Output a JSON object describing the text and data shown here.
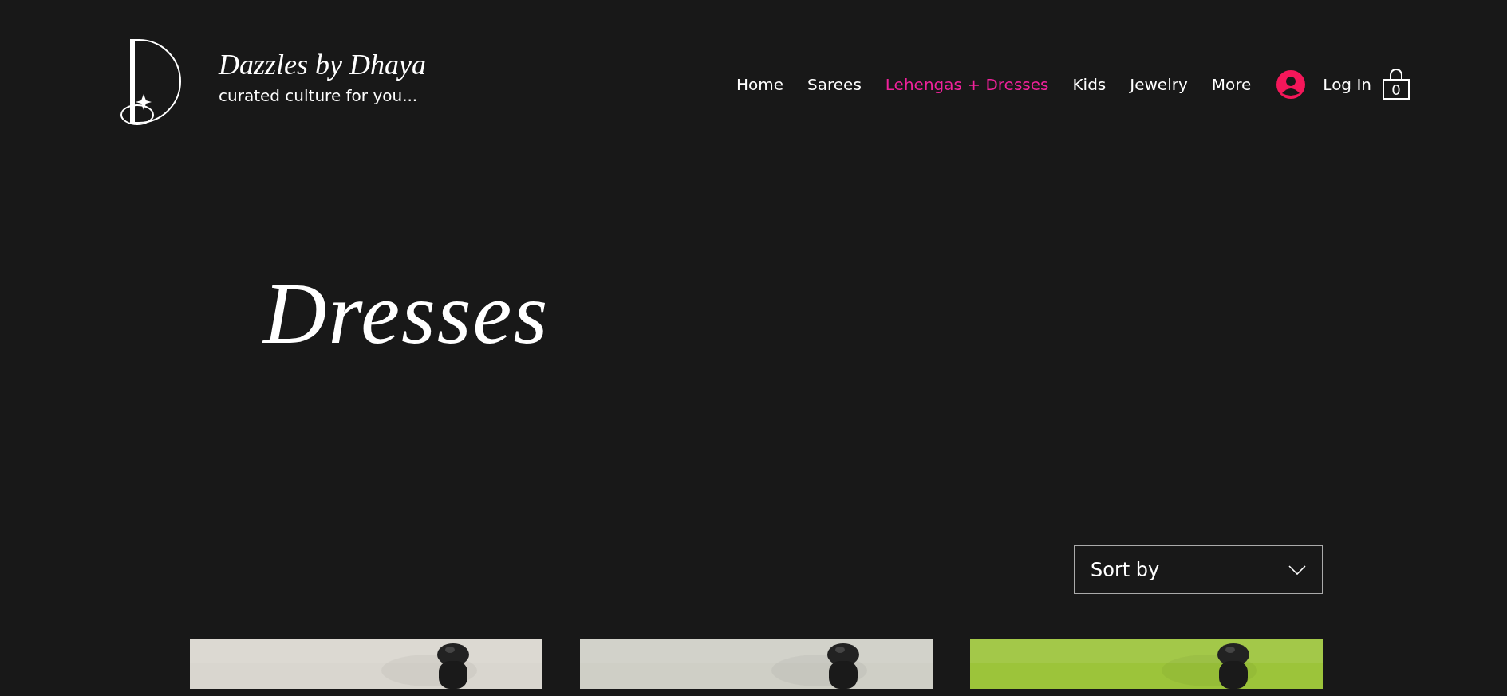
{
  "brand": {
    "name": "Dazzles by Dhaya",
    "tagline": "curated culture for you..."
  },
  "nav": [
    {
      "label": "Home",
      "selected": false
    },
    {
      "label": "Sarees",
      "selected": false
    },
    {
      "label": "Lehengas + Dresses",
      "selected": true
    },
    {
      "label": "Kids",
      "selected": false
    },
    {
      "label": "Jewelry",
      "selected": false
    },
    {
      "label": "More",
      "selected": false
    }
  ],
  "login": "Log In",
  "cart_count": "0",
  "page_title": "Dresses",
  "sort": {
    "placeholder": "Sort by"
  }
}
